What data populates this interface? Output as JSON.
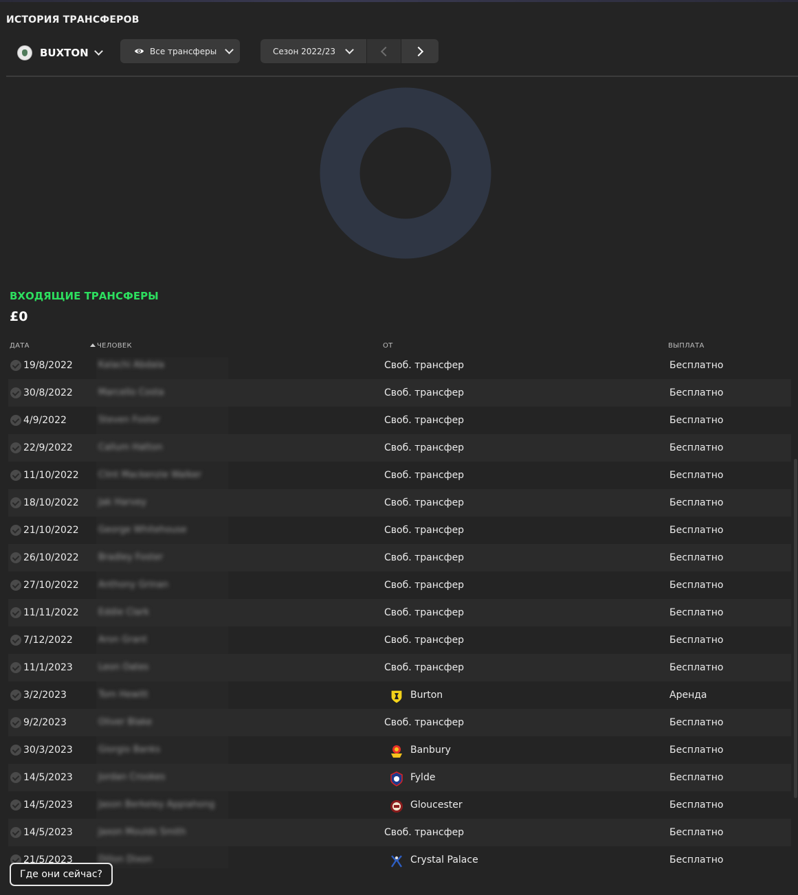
{
  "page_title": "ИСТОРИЯ ТРАНСФЕРОВ",
  "club_selector": {
    "name": "BUXTON",
    "icon": "club-crest-icon"
  },
  "filter": {
    "label": "Все трансферы",
    "icon": "eye-icon"
  },
  "season": {
    "label": "Сезон 2022/23"
  },
  "colors": {
    "accent_green": "#2ddf5f",
    "donut": "#2f3644",
    "background": "#242424"
  },
  "section": {
    "title": "ВХОДЯЩИЕ ТРАНСФЕРЫ",
    "total": "£0"
  },
  "columns": {
    "date": "ДАТА",
    "person": "ЧЕЛОВЕК",
    "from": "ОТ",
    "fee": "ВЫПЛАТА"
  },
  "rows": [
    {
      "date": "19/8/2022",
      "person": "Kalachi Abdala",
      "from": "Своб. трансфер",
      "fee": "Бесплатно",
      "crest": ""
    },
    {
      "date": "30/8/2022",
      "person": "Marcello Costa",
      "from": "Своб. трансфер",
      "fee": "Бесплатно",
      "crest": ""
    },
    {
      "date": "4/9/2022",
      "person": "Steven Foster",
      "from": "Своб. трансфер",
      "fee": "Бесплатно",
      "crest": ""
    },
    {
      "date": "22/9/2022",
      "person": "Callum Hatton",
      "from": "Своб. трансфер",
      "fee": "Бесплатно",
      "crest": ""
    },
    {
      "date": "11/10/2022",
      "person": "Clint Mackenzie Walker",
      "from": "Своб. трансфер",
      "fee": "Бесплатно",
      "crest": ""
    },
    {
      "date": "18/10/2022",
      "person": "Jak Harvey",
      "from": "Своб. трансфер",
      "fee": "Бесплатно",
      "crest": ""
    },
    {
      "date": "21/10/2022",
      "person": "George Whitehouse",
      "from": "Своб. трансфер",
      "fee": "Бесплатно",
      "crest": ""
    },
    {
      "date": "26/10/2022",
      "person": "Bradley Foster",
      "from": "Своб. трансфер",
      "fee": "Бесплатно",
      "crest": ""
    },
    {
      "date": "27/10/2022",
      "person": "Anthony Grinan",
      "from": "Своб. трансфер",
      "fee": "Бесплатно",
      "crest": ""
    },
    {
      "date": "11/11/2022",
      "person": "Eddie Clark",
      "from": "Своб. трансфер",
      "fee": "Бесплатно",
      "crest": ""
    },
    {
      "date": "7/12/2022",
      "person": "Aron Grant",
      "from": "Своб. трансфер",
      "fee": "Бесплатно",
      "crest": ""
    },
    {
      "date": "11/1/2023",
      "person": "Leon Oates",
      "from": "Своб. трансфер",
      "fee": "Бесплатно",
      "crest": ""
    },
    {
      "date": "3/2/2023",
      "person": "Tom Hewitt",
      "from": "Burton",
      "fee": "Аренда",
      "crest": "burton"
    },
    {
      "date": "9/2/2023",
      "person": "Oliver Blake",
      "from": "Своб. трансфер",
      "fee": "Бесплатно",
      "crest": ""
    },
    {
      "date": "30/3/2023",
      "person": "Giorgio Banks",
      "from": "Banbury",
      "fee": "Бесплатно",
      "crest": "banbury"
    },
    {
      "date": "14/5/2023",
      "person": "Jordan Crookes",
      "from": "Fylde",
      "fee": "Бесплатно",
      "crest": "fylde"
    },
    {
      "date": "14/5/2023",
      "person": "Jason Berkeley Appiahong",
      "from": "Gloucester",
      "fee": "Бесплатно",
      "crest": "gloucester"
    },
    {
      "date": "14/5/2023",
      "person": "Jaxon Moulds Smith",
      "from": "Своб. трансфер",
      "fee": "Бесплатно",
      "crest": ""
    },
    {
      "date": "21/5/2023",
      "person": "Dillon Dixon",
      "from": "Crystal Palace",
      "fee": "Бесплатно",
      "crest": "crystal-palace"
    }
  ],
  "footer_button": "Где они сейчас?"
}
